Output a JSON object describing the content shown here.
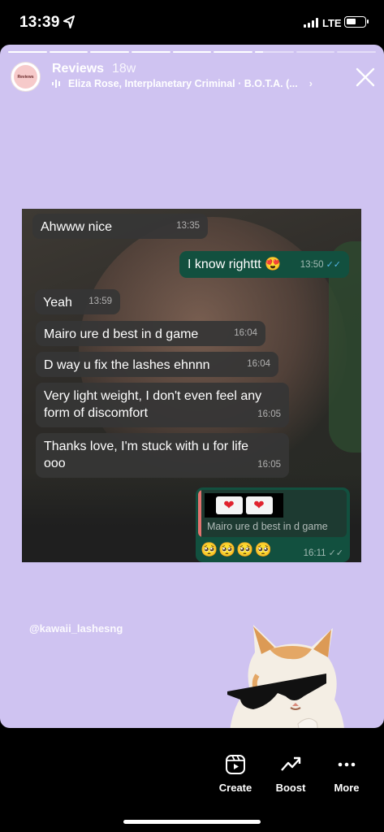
{
  "status_bar": {
    "time": "13:39",
    "network": "LTE"
  },
  "story": {
    "progress": {
      "segments_total": 9,
      "segments_completed": 6,
      "current_segment_fraction": 0.2
    },
    "avatar_text": "Reviews",
    "username": "Reviews",
    "posted_ago": "18w",
    "music": "Eliza Rose, Interplanetary Criminal · B.O.T.A. (...",
    "colors": {
      "background": "#cfc3f1",
      "outgoing_bubble": "#12503f",
      "incoming_bubble": "#363636",
      "read_ticks": "#55b7e8"
    },
    "handle": "@kawaii_lashesng",
    "sticker": "cat-with-sunglasses"
  },
  "chat": {
    "messages": [
      {
        "text": "Ahwww nice",
        "time": "13:35",
        "dir": "in"
      },
      {
        "text": "I know righttt 😍",
        "time": "13:50",
        "dir": "out",
        "ticks": "✓✓"
      },
      {
        "text": "Yeah",
        "time": "13:59",
        "dir": "in"
      },
      {
        "text": "Mairo ure d best in d game",
        "time": "16:04",
        "dir": "in"
      },
      {
        "text": "D way u fix the lashes ehnnn",
        "time": "16:04",
        "dir": "in"
      },
      {
        "text": "Very light weight, I don't even feel any form of discomfort",
        "time": "16:05",
        "dir": "in"
      },
      {
        "text": "Thanks love, I'm stuck with u for life ooo",
        "time": "16:05",
        "dir": "in"
      },
      {
        "text": "🥺🥺🥺🥺",
        "time": "16:11",
        "dir": "out",
        "ticks": "✓✓"
      }
    ],
    "reply_quote": "Mairo ure d best in d game",
    "reply_hearts": [
      "❤",
      "❤"
    ]
  },
  "actions": [
    {
      "label": "Create",
      "icon": "reels-icon"
    },
    {
      "label": "Boost",
      "icon": "trend-up-icon"
    },
    {
      "label": "More",
      "icon": "more-icon"
    }
  ]
}
